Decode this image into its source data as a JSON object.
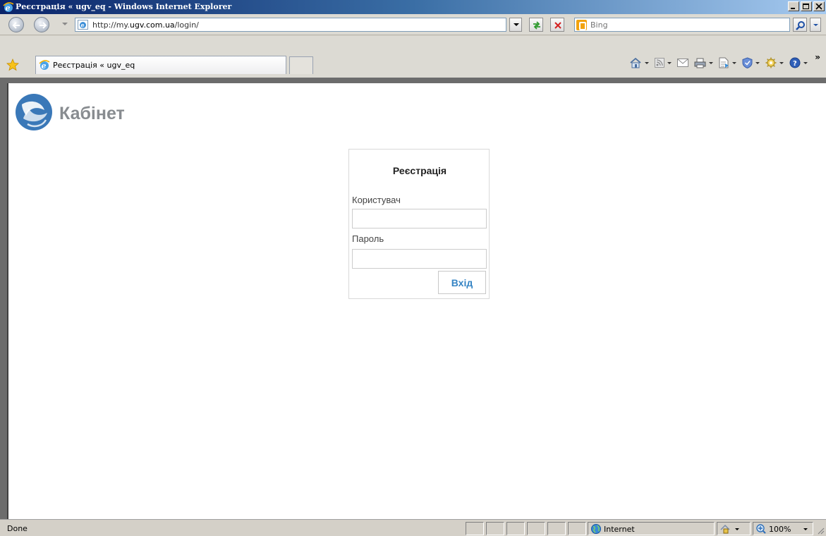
{
  "window": {
    "title": "Реєстрація « ugv_eq - Windows Internet Explorer"
  },
  "address_bar": {
    "url_prefix": "http://my.",
    "url_domain": "ugv.com.ua",
    "url_suffix": "/login/"
  },
  "search": {
    "placeholder": "Bing",
    "provider_icon": "bing-icon"
  },
  "tab": {
    "label": "Реєстрація « ugv_eq"
  },
  "command_bar": {
    "items": [
      "home-icon",
      "feeds-icon",
      "mail-icon",
      "print-icon",
      "page-icon",
      "safety-icon",
      "tools-icon",
      "help-icon"
    ]
  },
  "page": {
    "brand": "Кабінет",
    "login": {
      "title": "Реєстрація",
      "user_label": "Користувач",
      "password_label": "Пароль",
      "submit_label": "Вхід"
    }
  },
  "status_bar": {
    "status": "Done",
    "zone": "Internet",
    "zoom": "100%"
  },
  "colors": {
    "accent": "#3584c4",
    "brand_text": "#888c90",
    "titlebar": "#0a246a"
  }
}
